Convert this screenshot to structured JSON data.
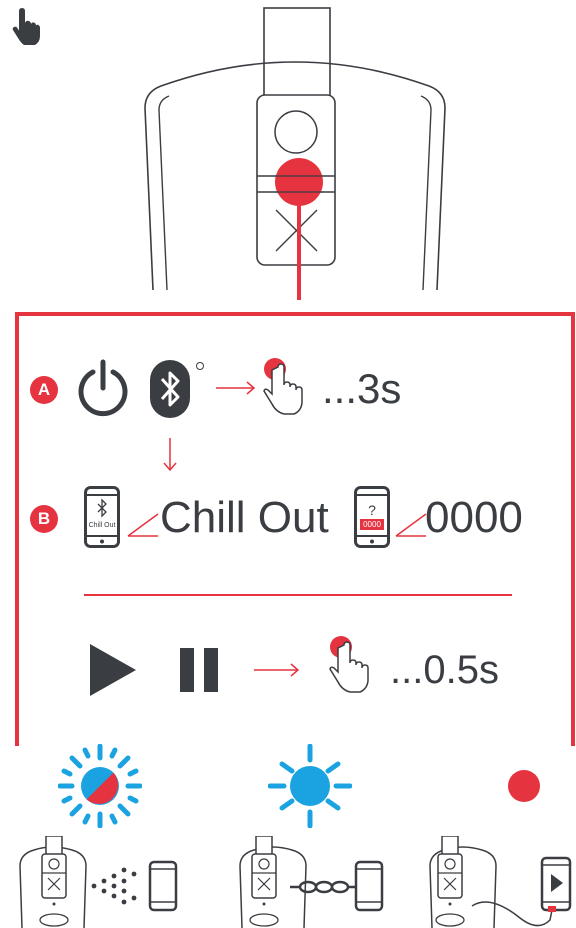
{
  "step_a": {
    "badge": "A",
    "duration": "...3s"
  },
  "step_b": {
    "badge": "B",
    "device_name": "Chill Out",
    "phone_screen_name": "Chill Out",
    "pin": "0000",
    "phone_screen_pin": "0000",
    "phone_screen_question": "?"
  },
  "playback": {
    "duration": "...0.5s"
  },
  "colors": {
    "accent": "#e5333f",
    "text": "#3a3d42",
    "blue": "#1aa3e0",
    "line": "#3a3d42"
  },
  "icons": {
    "cursor": "hand-pointer-icon",
    "power": "power-icon",
    "bluetooth": "bluetooth-icon",
    "press": "finger-press-icon",
    "play": "play-icon",
    "pause": "pause-icon"
  }
}
